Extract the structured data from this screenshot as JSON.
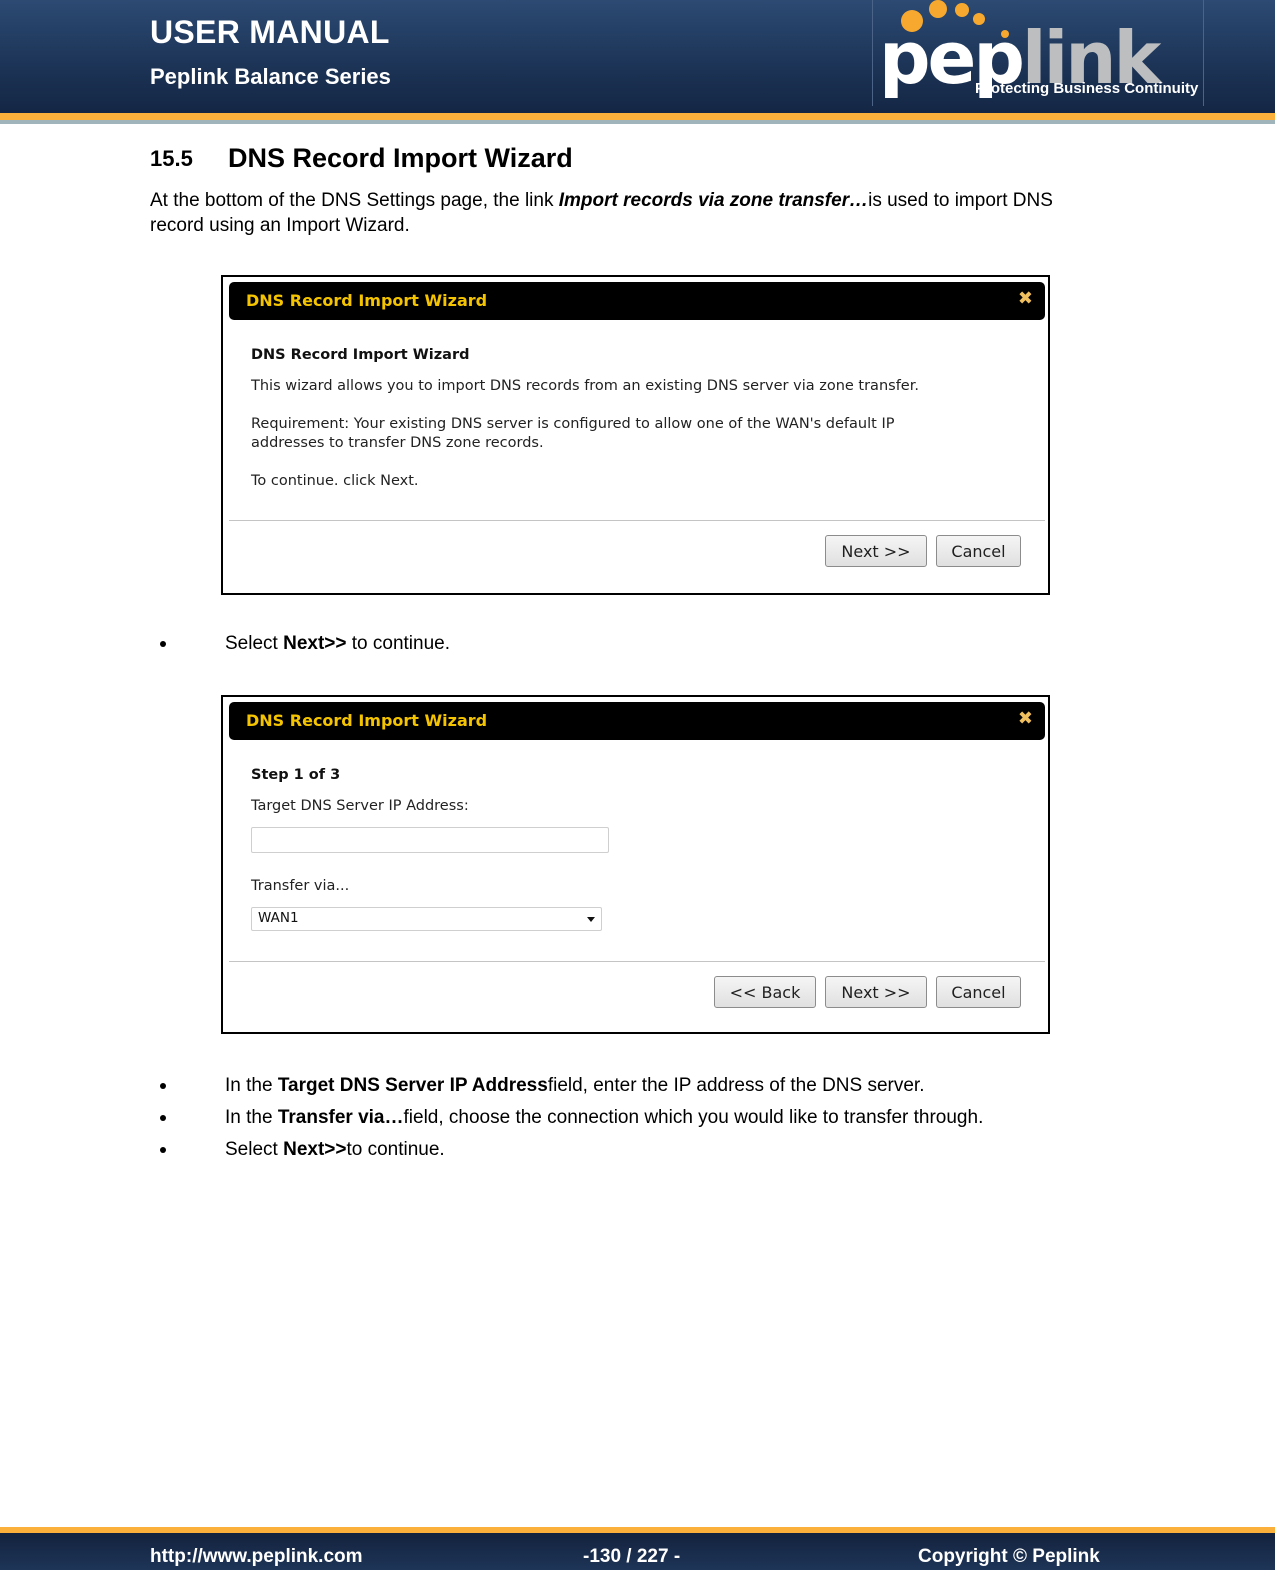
{
  "header": {
    "title": "USER MANUAL",
    "subtitle": "Peplink Balance Series",
    "logo": {
      "pep": "pep",
      "link": "link",
      "tagline": "Protecting Business Continuity"
    }
  },
  "section": {
    "number": "15.5",
    "title": "DNS Record Import Wizard",
    "intro_before": "At the bottom of the DNS Settings page, the link ",
    "intro_link": "Import records via zone transfer…",
    "intro_after": "is used to import DNS record using an Import Wizard."
  },
  "dialog1": {
    "title": "DNS Record Import Wizard",
    "close_icon": "✖",
    "heading": "DNS Record Import Wizard",
    "line1": "This wizard allows you to import DNS records from an existing DNS server via zone transfer.",
    "line2a": "Requirement: Your existing DNS server is configured to allow one of the WAN's default IP",
    "line2b": "addresses to transfer DNS zone records.",
    "line3": "To continue. click Next.",
    "next_label": "Next >>",
    "cancel_label": "Cancel"
  },
  "bullet1": {
    "pre": "Select ",
    "bold": "Next>>",
    "post": " to continue."
  },
  "dialog2": {
    "title": "DNS Record Import Wizard",
    "close_icon": "✖",
    "step": "Step 1 of 3",
    "ip_label": "Target DNS Server IP Address:",
    "ip_value": "",
    "transfer_label": "Transfer via...",
    "transfer_value": "WAN1",
    "back_label": "<< Back",
    "next_label": "Next >>",
    "cancel_label": "Cancel"
  },
  "bullets2": [
    {
      "pre": "In the ",
      "bold": "Target DNS Server IP Address",
      "post": "field, enter the IP address of the DNS server."
    },
    {
      "pre": "In the ",
      "bold": "Transfer via…",
      "post": "field, choose the connection which you would like to transfer through."
    },
    {
      "pre": "Select ",
      "bold": "Next>>",
      "post": "to continue."
    }
  ],
  "footer": {
    "url": "http://www.peplink.com",
    "page": "-130 / 227 -",
    "copyright": "Copyright ©  Peplink"
  },
  "colors": {
    "header_navy": "#1d3558",
    "accent_orange": "#fbb03b",
    "dialog_title_yellow": "#f5c400"
  }
}
